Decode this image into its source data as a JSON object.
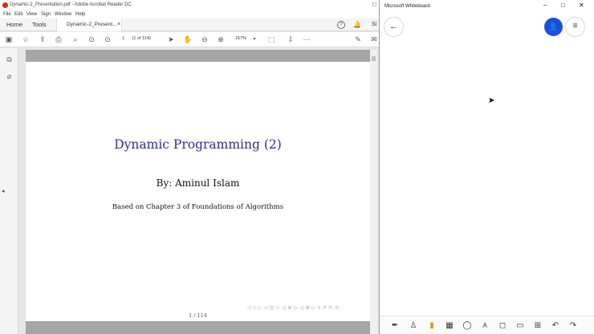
{
  "acrobat": {
    "window_title": "Dynamic-2_Presentation.pdf - Adobe Acrobat Reader DC",
    "menu": [
      "File",
      "Edit",
      "View",
      "Sign",
      "Window",
      "Help"
    ],
    "tabs": {
      "home": "Home",
      "tools": "Tools",
      "document": "Dynamic-2_Present..."
    },
    "tab_close": "×",
    "sign_in_partial": "Si",
    "toolbar": {
      "page_number": "1",
      "page_count": "(1 of 114)",
      "zoom": "167%"
    },
    "slide": {
      "title": "Dynamic Programming (2)",
      "author": "By:  Aminul Islam",
      "based_on": "Based on Chapter 3 of Foundations of Algorithms",
      "page_label": "1 / 114",
      "nav_symbols": "◁ □ ▷   ◁ ⊡ ▷   ◁ ≣ ▷   ◁ ≣ ▷   ≡   ↺ ↻ ⟲"
    }
  },
  "whiteboard": {
    "window_title": "Microsoft Whiteboard",
    "icons": {
      "back": "arrow-left-icon",
      "user": "user-icon",
      "menu": "hamburger-icon"
    },
    "tools": [
      "pen-icon",
      "highlighter-icon",
      "eraser-icon",
      "ruler-icon",
      "lasso-icon",
      "text-icon",
      "note-icon",
      "image-icon",
      "insert-icon",
      "undo-icon",
      "redo-icon"
    ]
  },
  "colors": {
    "slide_title": "#2e2e8c",
    "whiteboard_accent": "#1b4fe0",
    "acrobat_red": "#d9261c",
    "beamer_bar": "#a6a6a6"
  }
}
